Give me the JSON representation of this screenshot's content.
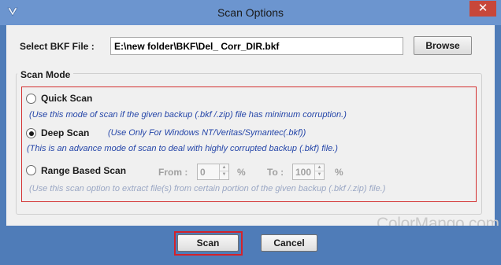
{
  "window": {
    "title": "Scan Options",
    "close_glyph": "✕",
    "app_icon": "v-logo-icon"
  },
  "file": {
    "label": "Select BKF File :",
    "path_value": "E:\\new folder\\BKF\\Del_ Corr_DIR.bkf",
    "browse_label": "Browse"
  },
  "scan_mode": {
    "legend": "Scan Mode",
    "selected": "deep",
    "quick": {
      "label": "Quick Scan",
      "hint": "(Use this mode of scan if the given backup (.bkf /.zip) file has minimum corruption.)"
    },
    "deep": {
      "label": "Deep Scan",
      "inline_hint": "(Use Only For Windows NT/Veritas/Symantec(.bkf))",
      "hint": "(This is an advance mode of scan to deal with highly corrupted backup (.bkf) file.)"
    },
    "range": {
      "label": "Range Based Scan",
      "from_label": "From :",
      "from_value": "0",
      "from_unit": "%",
      "to_label": "To :",
      "to_value": "100",
      "to_unit": "%",
      "hint": "(Use this scan option to extract file(s) from certain portion of the given backup (.bkf /.zip) file.)"
    }
  },
  "watermark": "ColorMango.com",
  "footer": {
    "scan_label": "Scan",
    "cancel_label": "Cancel"
  },
  "colors": {
    "titlebar": "#6c95cf",
    "frame": "#4f7cb8",
    "close": "#c7473a",
    "highlight_border": "#d33030",
    "hint_text": "#2445a8"
  }
}
